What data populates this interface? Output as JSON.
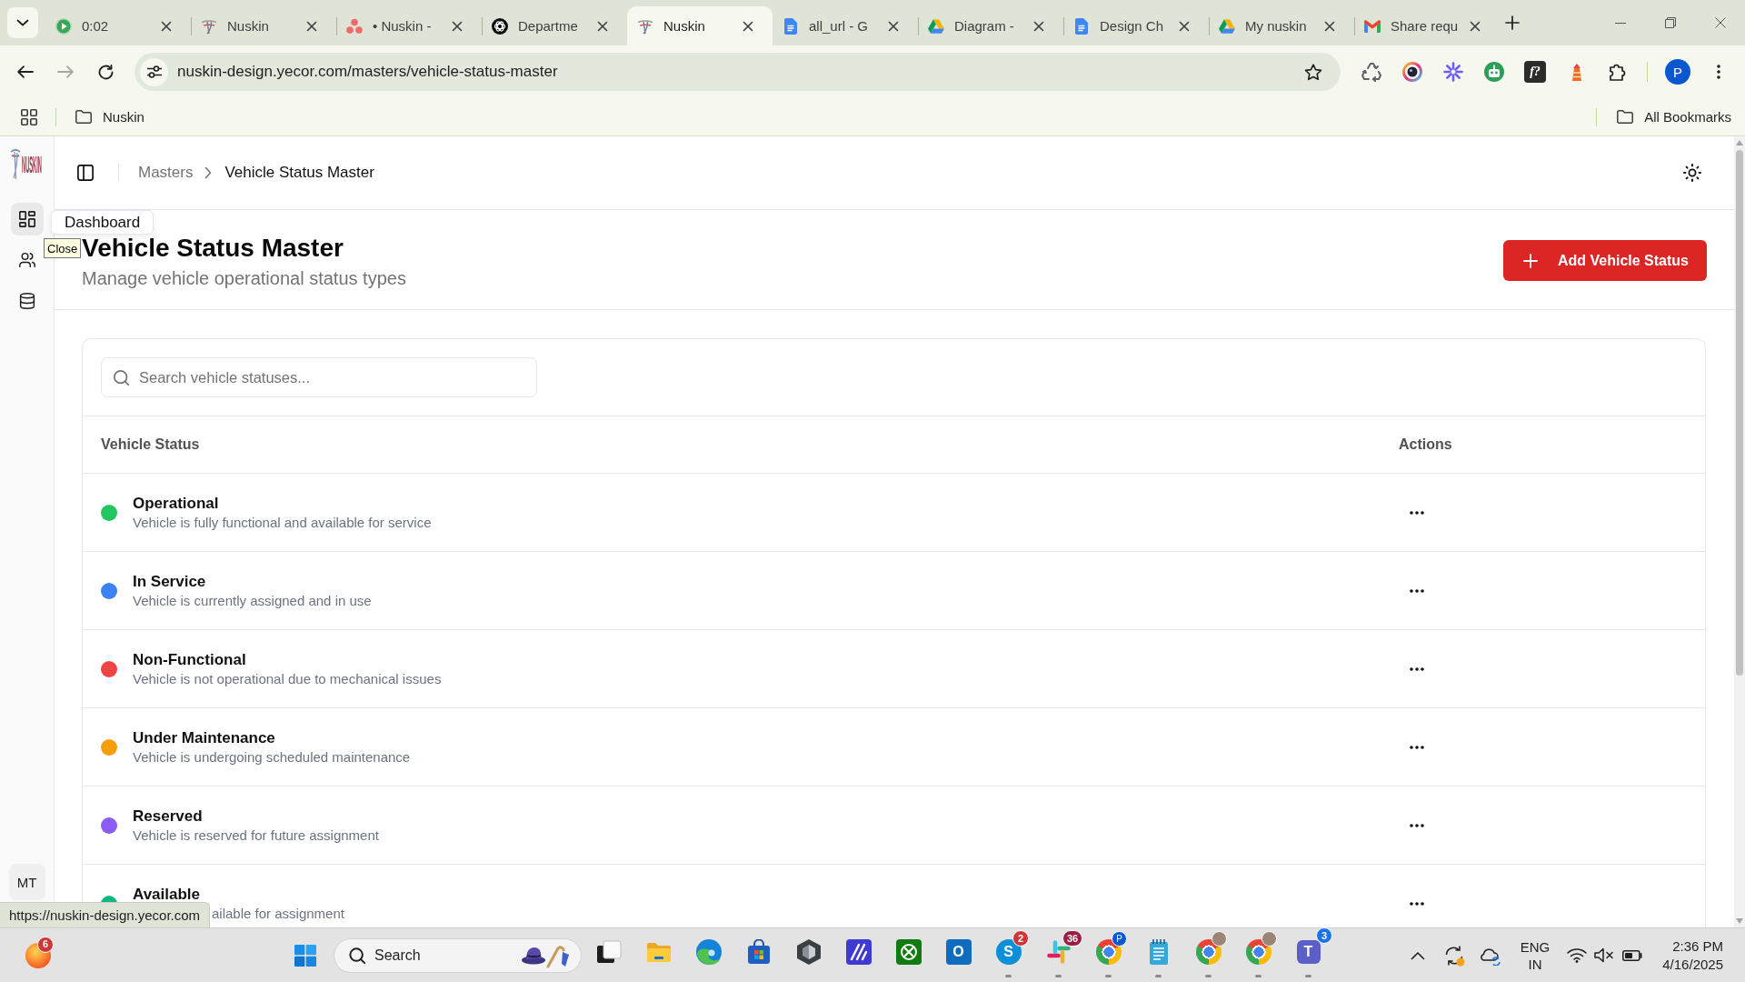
{
  "browser": {
    "tabs": [
      {
        "title": "0:02",
        "kind": "play",
        "selected": false
      },
      {
        "title": "Nuskin",
        "kind": "logo",
        "selected": false
      },
      {
        "title": "• Nuskin -",
        "kind": "dots",
        "selected": false
      },
      {
        "title": "Departme",
        "kind": "knot",
        "selected": false
      },
      {
        "title": "Nuskin",
        "kind": "logo",
        "selected": true
      },
      {
        "title": "all_url - G",
        "kind": "doc",
        "selected": false
      },
      {
        "title": "Diagram -",
        "kind": "triangle",
        "selected": false
      },
      {
        "title": "Design Ch",
        "kind": "doc",
        "selected": false
      },
      {
        "title": "My nuskin",
        "kind": "triangle",
        "selected": false
      },
      {
        "title": "Share requ",
        "kind": "mail",
        "selected": false
      }
    ],
    "nav": {
      "back_disabled": false,
      "forward_disabled": true
    },
    "address": "nuskin-design.yecor.com/masters/vehicle-status-master",
    "extensions": [
      {
        "kind": "recycle"
      },
      {
        "kind": "lens"
      },
      {
        "kind": "sparkle"
      },
      {
        "kind": "robot"
      },
      {
        "kind": "letters",
        "glyph": "f?"
      },
      {
        "kind": "lighthouse"
      },
      {
        "kind": "puzzle"
      }
    ],
    "profile": "P",
    "bookmarks": [
      {
        "label": "Nuskin"
      }
    ],
    "all_bookmarks": "All Bookmarks",
    "tooltip": "Close",
    "status_url": "https://nuskin-design.yecor.com"
  },
  "sidebar": {
    "logo_text": "NUSKIN",
    "items": [
      {
        "kind": "grid",
        "hovered": true
      },
      {
        "kind": "users",
        "hovered": false
      },
      {
        "kind": "database",
        "hovered": false
      }
    ],
    "tooltip": "Dashboard",
    "avatar": "MT"
  },
  "header": {
    "breadcrumb": [
      {
        "label": "Masters",
        "current": false
      },
      {
        "label": "Vehicle Status Master",
        "current": true
      }
    ]
  },
  "page": {
    "title": "Vehicle Status Master",
    "subtitle": "Manage vehicle operational status types",
    "add_button": "Add Vehicle Status"
  },
  "table": {
    "search_placeholder": "Search vehicle statuses...",
    "columns": [
      "Vehicle Status",
      "Actions"
    ],
    "rows": [
      {
        "name": "Operational",
        "description": "Vehicle is fully functional and available for service",
        "color": "#22c55e"
      },
      {
        "name": "In Service",
        "description": "Vehicle is currently assigned and in use",
        "color": "#3b82f6"
      },
      {
        "name": "Non-Functional",
        "description": "Vehicle is not operational due to mechanical issues",
        "color": "#ef4444"
      },
      {
        "name": "Under Maintenance",
        "description": "Vehicle is undergoing scheduled maintenance",
        "color": "#f59e0b"
      },
      {
        "name": "Reserved",
        "description": "Vehicle is reserved for future assignment",
        "color": "#8b5cf6"
      },
      {
        "name": "Available",
        "description": "ailable for assignment",
        "color": "#10b981"
      }
    ]
  },
  "taskbar": {
    "widget_badge": "6",
    "search_label": "Search",
    "apps": [
      {
        "kind": "taskview",
        "running": false
      },
      {
        "kind": "folder",
        "running": false
      },
      {
        "kind": "wave",
        "running": false
      },
      {
        "kind": "store",
        "running": false
      },
      {
        "kind": "hexagon",
        "running": false
      },
      {
        "kind": "stripes",
        "running": false
      },
      {
        "kind": "sphere",
        "running": false
      },
      {
        "kind": "mail",
        "glyph": "O",
        "running": false
      },
      {
        "kind": "chat",
        "glyph": "S",
        "badge": "2",
        "running": true
      },
      {
        "kind": "hash",
        "badge": "36",
        "running": true
      },
      {
        "kind": "chrome",
        "overlay": {
          "kind": "letter",
          "glyph": "P"
        },
        "running": true
      },
      {
        "kind": "notepad",
        "running": true
      },
      {
        "kind": "chrome",
        "overlay": {
          "kind": "photo"
        },
        "running": true
      },
      {
        "kind": "chrome",
        "overlay": {
          "kind": "photo"
        },
        "running": true
      },
      {
        "kind": "team",
        "glyph": "T",
        "badge": "3",
        "running": true
      }
    ],
    "language": "ENG",
    "region": "IN",
    "time": "2:36 PM",
    "date": "4/16/2025"
  }
}
